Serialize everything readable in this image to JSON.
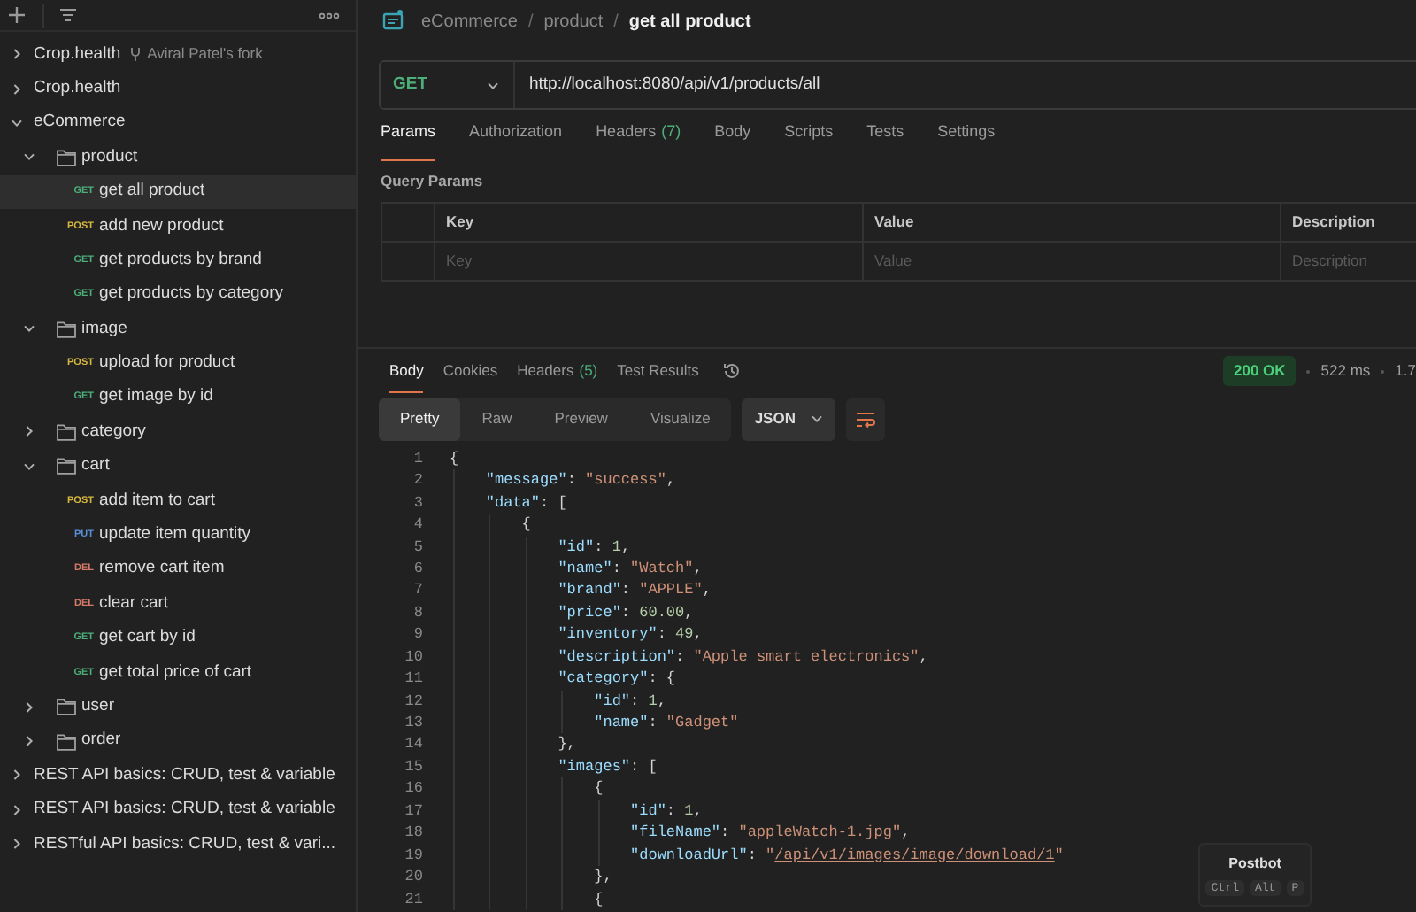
{
  "sidebar": {
    "tree": [
      {
        "kind": "collection",
        "name": "Crop.health",
        "fork": "Aviral Patel's fork",
        "expanded": false,
        "selected": false
      },
      {
        "kind": "collection",
        "name": "Crop.health",
        "expanded": false,
        "selected": false
      },
      {
        "kind": "collection",
        "name": "eCommerce",
        "expanded": true,
        "selected": false,
        "children": [
          {
            "kind": "folder",
            "name": "product",
            "expanded": true,
            "selected": false,
            "children": [
              {
                "kind": "request",
                "method": "GET",
                "color": "#4caf7a",
                "name": "get all product",
                "selected": true
              },
              {
                "kind": "request",
                "method": "POST",
                "color": "#d6b63f",
                "name": "add new product",
                "selected": false
              },
              {
                "kind": "request",
                "method": "GET",
                "color": "#4caf7a",
                "name": "get products by brand",
                "selected": false
              },
              {
                "kind": "request",
                "method": "GET",
                "color": "#4caf7a",
                "name": "get products by category",
                "selected": false
              }
            ]
          },
          {
            "kind": "folder",
            "name": "image",
            "expanded": true,
            "selected": false,
            "children": [
              {
                "kind": "request",
                "method": "POST",
                "color": "#d6b63f",
                "name": "upload for product",
                "selected": false
              },
              {
                "kind": "request",
                "method": "GET",
                "color": "#4caf7a",
                "name": "get image by id",
                "selected": false
              }
            ]
          },
          {
            "kind": "folder",
            "name": "category",
            "expanded": false,
            "selected": false
          },
          {
            "kind": "folder",
            "name": "cart",
            "expanded": true,
            "selected": false,
            "children": [
              {
                "kind": "request",
                "method": "POST",
                "color": "#d6b63f",
                "name": "add item to cart",
                "selected": false
              },
              {
                "kind": "request",
                "method": "PUT",
                "color": "#5a8fd6",
                "name": "update item quantity",
                "selected": false
              },
              {
                "kind": "request",
                "method": "DEL",
                "color": "#d67a6a",
                "name": "remove cart item",
                "selected": false
              },
              {
                "kind": "request",
                "method": "DEL",
                "color": "#d67a6a",
                "name": "clear cart",
                "selected": false
              },
              {
                "kind": "request",
                "method": "GET",
                "color": "#4caf7a",
                "name": "get cart by id",
                "selected": false
              },
              {
                "kind": "request",
                "method": "GET",
                "color": "#4caf7a",
                "name": "get total price of cart",
                "selected": false
              }
            ]
          },
          {
            "kind": "folder",
            "name": "user",
            "expanded": false,
            "selected": false
          },
          {
            "kind": "folder",
            "name": "order",
            "expanded": false,
            "selected": false
          }
        ]
      },
      {
        "kind": "collection",
        "name": "REST API basics: CRUD, test & variable",
        "expanded": false,
        "selected": false
      },
      {
        "kind": "collection",
        "name": "REST API basics: CRUD, test & variable",
        "expanded": false,
        "selected": false
      },
      {
        "kind": "collection",
        "name": "RESTful API basics: CRUD, test & vari...",
        "expanded": false,
        "selected": false
      }
    ]
  },
  "breadcrumb": [
    {
      "kind": "crumb",
      "text": "eCommerce"
    },
    {
      "kind": "separator",
      "text": "/"
    },
    {
      "kind": "crumb",
      "text": "product"
    },
    {
      "kind": "separator",
      "text": "/"
    },
    {
      "kind": "current",
      "text": "get all product"
    }
  ],
  "request": {
    "method": "GET",
    "url": "http://localhost:8080/api/v1/products/all"
  },
  "request_tabs": [
    {
      "label": "Params",
      "selected": true
    },
    {
      "label": "Authorization",
      "selected": false
    },
    {
      "label": "Headers",
      "count": "(7)",
      "selected": false
    },
    {
      "label": "Body",
      "selected": false
    },
    {
      "label": "Scripts",
      "selected": false
    },
    {
      "label": "Tests",
      "selected": false
    },
    {
      "label": "Settings",
      "selected": false
    }
  ],
  "query_params": {
    "title": "Query Params",
    "columns": [
      "Key",
      "Value",
      "Description"
    ],
    "placeholders": [
      "Key",
      "Value",
      "Description"
    ]
  },
  "response_tabs": [
    {
      "label": "Body",
      "selected": true
    },
    {
      "label": "Cookies",
      "selected": false
    },
    {
      "label": "Headers",
      "count": "(5)",
      "selected": false
    },
    {
      "label": "Test Results",
      "selected": false
    }
  ],
  "status": {
    "code": "200 OK",
    "time": "522 ms",
    "size": "1.7"
  },
  "view_modes": [
    {
      "label": "Pretty",
      "selected": true
    },
    {
      "label": "Raw",
      "selected": false
    },
    {
      "label": "Preview",
      "selected": false
    },
    {
      "label": "Visualize",
      "selected": false
    }
  ],
  "format": "JSON",
  "code_lines": [
    {
      "number": "1",
      "tokens": [
        {
          "kind": "punct",
          "text": "{"
        }
      ]
    },
    {
      "number": "2",
      "tokens": [
        {
          "kind": "key",
          "text": "    \"message\""
        },
        {
          "kind": "punct",
          "text": ": "
        },
        {
          "kind": "string",
          "text": "\"success\""
        },
        {
          "kind": "punct",
          "text": ","
        }
      ]
    },
    {
      "number": "3",
      "tokens": [
        {
          "kind": "key",
          "text": "    \"data\""
        },
        {
          "kind": "punct",
          "text": ": ["
        }
      ]
    },
    {
      "number": "4",
      "tokens": [
        {
          "kind": "punct",
          "text": "        {"
        }
      ]
    },
    {
      "number": "5",
      "tokens": [
        {
          "kind": "key",
          "text": "            \"id\""
        },
        {
          "kind": "punct",
          "text": ": "
        },
        {
          "kind": "number",
          "text": "1"
        },
        {
          "kind": "punct",
          "text": ","
        }
      ]
    },
    {
      "number": "6",
      "tokens": [
        {
          "kind": "key",
          "text": "            \"name\""
        },
        {
          "kind": "punct",
          "text": ": "
        },
        {
          "kind": "string",
          "text": "\"Watch\""
        },
        {
          "kind": "punct",
          "text": ","
        }
      ]
    },
    {
      "number": "7",
      "tokens": [
        {
          "kind": "key",
          "text": "            \"brand\""
        },
        {
          "kind": "punct",
          "text": ": "
        },
        {
          "kind": "string",
          "text": "\"APPLE\""
        },
        {
          "kind": "punct",
          "text": ","
        }
      ]
    },
    {
      "number": "8",
      "tokens": [
        {
          "kind": "key",
          "text": "            \"price\""
        },
        {
          "kind": "punct",
          "text": ": "
        },
        {
          "kind": "number",
          "text": "60.00"
        },
        {
          "kind": "punct",
          "text": ","
        }
      ]
    },
    {
      "number": "9",
      "tokens": [
        {
          "kind": "key",
          "text": "            \"inventory\""
        },
        {
          "kind": "punct",
          "text": ": "
        },
        {
          "kind": "number",
          "text": "49"
        },
        {
          "kind": "punct",
          "text": ","
        }
      ]
    },
    {
      "number": "10",
      "tokens": [
        {
          "kind": "key",
          "text": "            \"description\""
        },
        {
          "kind": "punct",
          "text": ": "
        },
        {
          "kind": "string",
          "text": "\"Apple smart electronics\""
        },
        {
          "kind": "punct",
          "text": ","
        }
      ]
    },
    {
      "number": "11",
      "tokens": [
        {
          "kind": "key",
          "text": "            \"category\""
        },
        {
          "kind": "punct",
          "text": ": {"
        }
      ]
    },
    {
      "number": "12",
      "tokens": [
        {
          "kind": "key",
          "text": "                \"id\""
        },
        {
          "kind": "punct",
          "text": ": "
        },
        {
          "kind": "number",
          "text": "1"
        },
        {
          "kind": "punct",
          "text": ","
        }
      ]
    },
    {
      "number": "13",
      "tokens": [
        {
          "kind": "key",
          "text": "                \"name\""
        },
        {
          "kind": "punct",
          "text": ": "
        },
        {
          "kind": "string",
          "text": "\"Gadget\""
        }
      ]
    },
    {
      "number": "14",
      "tokens": [
        {
          "kind": "punct",
          "text": "            },"
        }
      ]
    },
    {
      "number": "15",
      "tokens": [
        {
          "kind": "key",
          "text": "            \"images\""
        },
        {
          "kind": "punct",
          "text": ": ["
        }
      ]
    },
    {
      "number": "16",
      "tokens": [
        {
          "kind": "punct",
          "text": "                {"
        }
      ]
    },
    {
      "number": "17",
      "tokens": [
        {
          "kind": "key",
          "text": "                    \"id\""
        },
        {
          "kind": "punct",
          "text": ": "
        },
        {
          "kind": "number",
          "text": "1"
        },
        {
          "kind": "punct",
          "text": ","
        }
      ]
    },
    {
      "number": "18",
      "tokens": [
        {
          "kind": "key",
          "text": "                    \"fileName\""
        },
        {
          "kind": "punct",
          "text": ": "
        },
        {
          "kind": "string",
          "text": "\"appleWatch-1.jpg\""
        },
        {
          "kind": "punct",
          "text": ","
        }
      ]
    },
    {
      "number": "19",
      "tokens": [
        {
          "kind": "key",
          "text": "                    \"downloadUrl\""
        },
        {
          "kind": "punct",
          "text": ": "
        },
        {
          "kind": "string",
          "text": "\""
        },
        {
          "kind": "link",
          "text": "/api/v1/images/image/download/1"
        },
        {
          "kind": "string",
          "text": "\""
        }
      ]
    },
    {
      "number": "20",
      "tokens": [
        {
          "kind": "punct",
          "text": "                },"
        }
      ]
    },
    {
      "number": "21",
      "tokens": [
        {
          "kind": "punct",
          "text": "                {"
        }
      ]
    }
  ],
  "postbot": {
    "title": "Postbot",
    "keys": [
      "Ctrl",
      "Alt",
      "P"
    ]
  }
}
